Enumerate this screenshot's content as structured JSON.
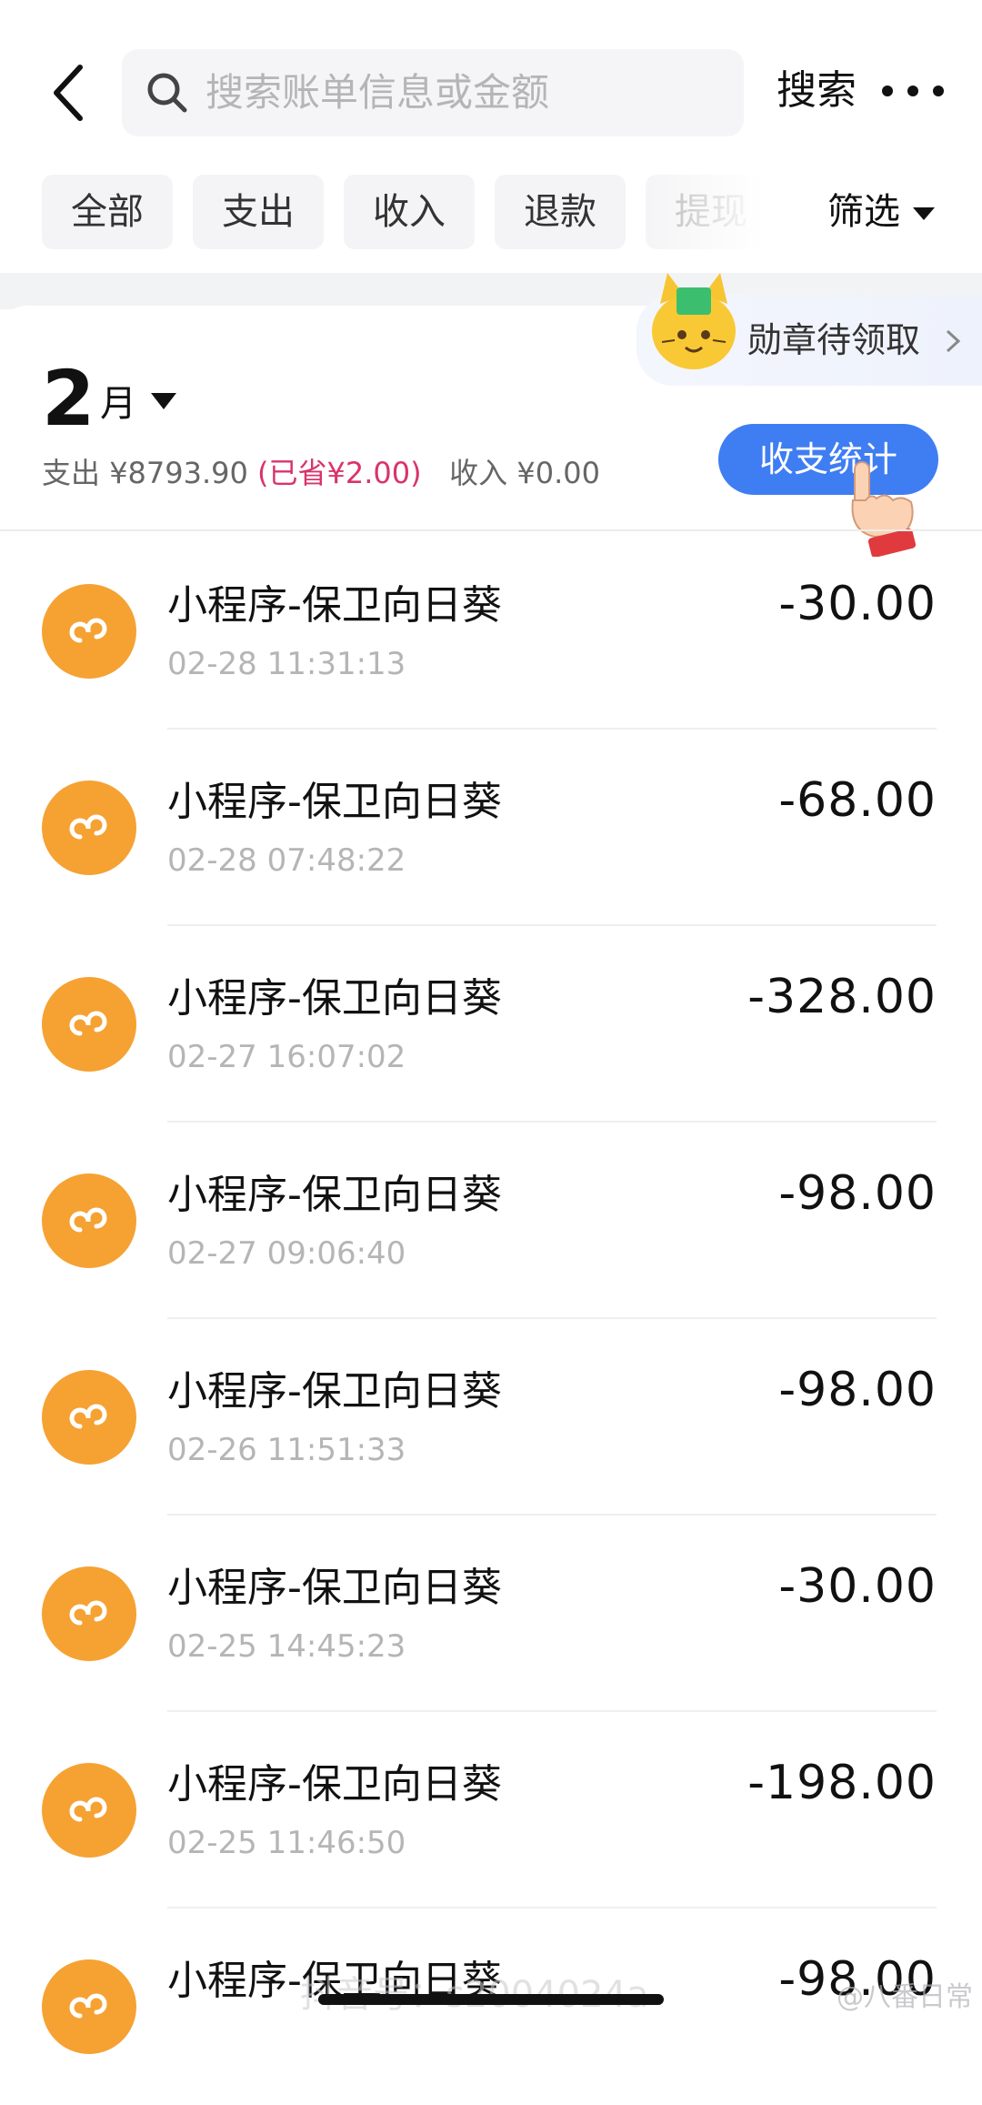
{
  "header": {
    "search_placeholder": "搜索账单信息或金额",
    "search_button": "搜索"
  },
  "tabs": [
    {
      "label": "全部"
    },
    {
      "label": "支出"
    },
    {
      "label": "收入"
    },
    {
      "label": "退款"
    },
    {
      "label": "提现"
    }
  ],
  "filter_label": "筛选",
  "badge_label": "勋章待领取",
  "summary": {
    "month_number": "2",
    "month_unit": "月",
    "expense_label": "支出",
    "expense_amount": "¥8793.90",
    "saved": "(已省¥2.00)",
    "income_label": "收入",
    "income_amount": "¥0.00",
    "stats_button": "收支统计"
  },
  "transactions": [
    {
      "title": "小程序-保卫向日葵",
      "time": "02-28 11:31:13",
      "amount": "-30.00"
    },
    {
      "title": "小程序-保卫向日葵",
      "time": "02-28 07:48:22",
      "amount": "-68.00"
    },
    {
      "title": "小程序-保卫向日葵",
      "time": "02-27 16:07:02",
      "amount": "-328.00"
    },
    {
      "title": "小程序-保卫向日葵",
      "time": "02-27 09:06:40",
      "amount": "-98.00"
    },
    {
      "title": "小程序-保卫向日葵",
      "time": "02-26 11:51:33",
      "amount": "-98.00"
    },
    {
      "title": "小程序-保卫向日葵",
      "time": "02-25 14:45:23",
      "amount": "-30.00"
    },
    {
      "title": "小程序-保卫向日葵",
      "time": "02-25 11:46:50",
      "amount": "-198.00"
    },
    {
      "title": "小程序-保卫向日葵",
      "time": "",
      "amount": "-98.00"
    }
  ],
  "watermark": {
    "center": "抖音号：s2004024a",
    "right": "@八番日常"
  },
  "colors": {
    "accent_blue": "#3f7df3",
    "app_icon_orange": "#f5a233",
    "saved_red": "#d8346a"
  },
  "icons": {
    "back": "chevron-left-icon",
    "search": "search-icon",
    "more": "more-dots-icon",
    "app": "mini-program-icon",
    "mascot": "cat-mascot-icon",
    "hand": "pointing-hand-icon"
  }
}
